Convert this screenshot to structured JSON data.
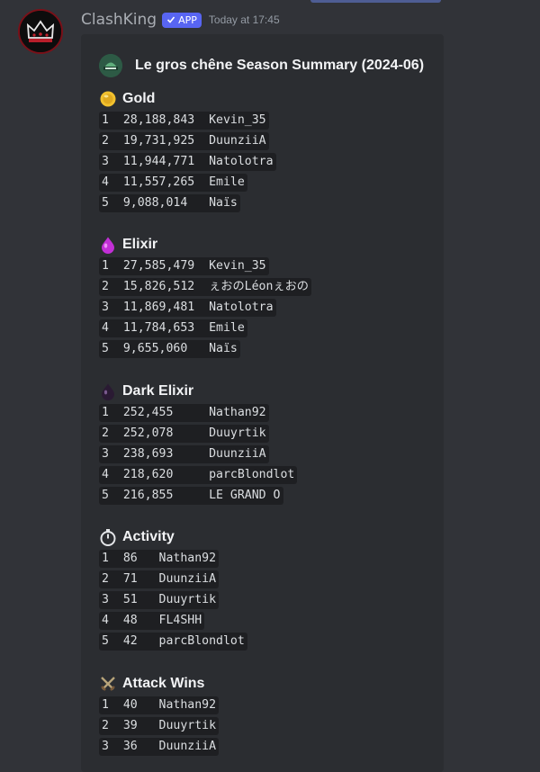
{
  "message": {
    "author": "ClashKing",
    "badge": "APP",
    "timestamp": "Today at 17:45"
  },
  "embed": {
    "title": "Le gros chêne Season Summary (2024-06)",
    "sections": [
      {
        "title": "Gold",
        "icon": "gold-coin-icon",
        "rows": [
          "1  28,188,843  Kevin_35",
          "2  19,731,925  DuunziiA",
          "3  11,944,771  Natolotra",
          "4  11,557,265  Emile",
          "5  9,088,014   Naïs"
        ]
      },
      {
        "title": "Elixir",
        "icon": "elixir-drop-icon",
        "rows": [
          "1  27,585,479  Kevin_35",
          "2  15,826,512  ぇおのLéonぇおの",
          "3  11,869,481  Natolotra",
          "4  11,784,653  Emile",
          "5  9,655,060   Naïs"
        ]
      },
      {
        "title": "Dark Elixir",
        "icon": "dark-elixir-drop-icon",
        "rows": [
          "1  252,455     Nathan92",
          "2  252,078     Duuyrtik",
          "3  238,693     DuunziiA",
          "4  218,620     parcBlondlot",
          "5  216,855     LE GRAND O"
        ]
      },
      {
        "title": "Activity",
        "icon": "stopwatch-icon",
        "rows": [
          "1  86   Nathan92",
          "2  71   DuunziiA",
          "3  51   Duuyrtik",
          "4  48   FL4SHH",
          "5  42   parcBlondlot"
        ]
      },
      {
        "title": "Attack Wins",
        "icon": "crossed-swords-icon",
        "rows": [
          "1  40   Nathan92",
          "2  39   Duuyrtik",
          "3  36   DuunziiA"
        ]
      }
    ]
  },
  "colors": {
    "background": "#313338",
    "embed_background": "#2b2d31",
    "code_background": "#1e1f22",
    "badge": "#5865f2"
  }
}
